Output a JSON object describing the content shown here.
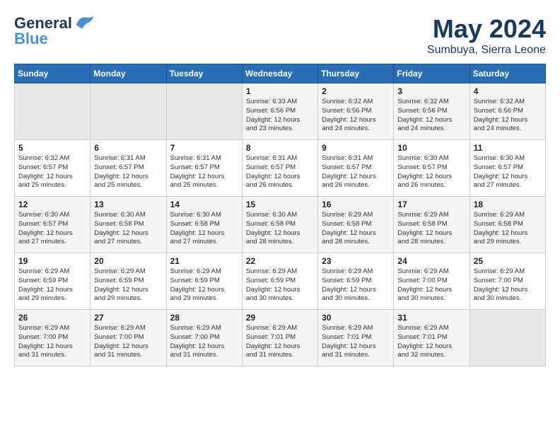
{
  "header": {
    "logo_line1": "General",
    "logo_line2": "Blue",
    "month": "May 2024",
    "location": "Sumbuya, Sierra Leone"
  },
  "weekdays": [
    "Sunday",
    "Monday",
    "Tuesday",
    "Wednesday",
    "Thursday",
    "Friday",
    "Saturday"
  ],
  "weeks": [
    [
      {
        "day": "",
        "info": ""
      },
      {
        "day": "",
        "info": ""
      },
      {
        "day": "",
        "info": ""
      },
      {
        "day": "1",
        "info": "Sunrise: 6:33 AM\nSunset: 6:56 PM\nDaylight: 12 hours\nand 23 minutes."
      },
      {
        "day": "2",
        "info": "Sunrise: 6:32 AM\nSunset: 6:56 PM\nDaylight: 12 hours\nand 24 minutes."
      },
      {
        "day": "3",
        "info": "Sunrise: 6:32 AM\nSunset: 6:56 PM\nDaylight: 12 hours\nand 24 minutes."
      },
      {
        "day": "4",
        "info": "Sunrise: 6:32 AM\nSunset: 6:56 PM\nDaylight: 12 hours\nand 24 minutes."
      }
    ],
    [
      {
        "day": "5",
        "info": "Sunrise: 6:32 AM\nSunset: 6:57 PM\nDaylight: 12 hours\nand 25 minutes."
      },
      {
        "day": "6",
        "info": "Sunrise: 6:31 AM\nSunset: 6:57 PM\nDaylight: 12 hours\nand 25 minutes."
      },
      {
        "day": "7",
        "info": "Sunrise: 6:31 AM\nSunset: 6:57 PM\nDaylight: 12 hours\nand 25 minutes."
      },
      {
        "day": "8",
        "info": "Sunrise: 6:31 AM\nSunset: 6:57 PM\nDaylight: 12 hours\nand 26 minutes."
      },
      {
        "day": "9",
        "info": "Sunrise: 6:31 AM\nSunset: 6:57 PM\nDaylight: 12 hours\nand 26 minutes."
      },
      {
        "day": "10",
        "info": "Sunrise: 6:30 AM\nSunset: 6:57 PM\nDaylight: 12 hours\nand 26 minutes."
      },
      {
        "day": "11",
        "info": "Sunrise: 6:30 AM\nSunset: 6:57 PM\nDaylight: 12 hours\nand 27 minutes."
      }
    ],
    [
      {
        "day": "12",
        "info": "Sunrise: 6:30 AM\nSunset: 6:57 PM\nDaylight: 12 hours\nand 27 minutes."
      },
      {
        "day": "13",
        "info": "Sunrise: 6:30 AM\nSunset: 6:58 PM\nDaylight: 12 hours\nand 27 minutes."
      },
      {
        "day": "14",
        "info": "Sunrise: 6:30 AM\nSunset: 6:58 PM\nDaylight: 12 hours\nand 27 minutes."
      },
      {
        "day": "15",
        "info": "Sunrise: 6:30 AM\nSunset: 6:58 PM\nDaylight: 12 hours\nand 28 minutes."
      },
      {
        "day": "16",
        "info": "Sunrise: 6:29 AM\nSunset: 6:58 PM\nDaylight: 12 hours\nand 28 minutes."
      },
      {
        "day": "17",
        "info": "Sunrise: 6:29 AM\nSunset: 6:58 PM\nDaylight: 12 hours\nand 28 minutes."
      },
      {
        "day": "18",
        "info": "Sunrise: 6:29 AM\nSunset: 6:58 PM\nDaylight: 12 hours\nand 29 minutes."
      }
    ],
    [
      {
        "day": "19",
        "info": "Sunrise: 6:29 AM\nSunset: 6:59 PM\nDaylight: 12 hours\nand 29 minutes."
      },
      {
        "day": "20",
        "info": "Sunrise: 6:29 AM\nSunset: 6:59 PM\nDaylight: 12 hours\nand 29 minutes."
      },
      {
        "day": "21",
        "info": "Sunrise: 6:29 AM\nSunset: 6:59 PM\nDaylight: 12 hours\nand 29 minutes."
      },
      {
        "day": "22",
        "info": "Sunrise: 6:29 AM\nSunset: 6:59 PM\nDaylight: 12 hours\nand 30 minutes."
      },
      {
        "day": "23",
        "info": "Sunrise: 6:29 AM\nSunset: 6:59 PM\nDaylight: 12 hours\nand 30 minutes."
      },
      {
        "day": "24",
        "info": "Sunrise: 6:29 AM\nSunset: 7:00 PM\nDaylight: 12 hours\nand 30 minutes."
      },
      {
        "day": "25",
        "info": "Sunrise: 6:29 AM\nSunset: 7:00 PM\nDaylight: 12 hours\nand 30 minutes."
      }
    ],
    [
      {
        "day": "26",
        "info": "Sunrise: 6:29 AM\nSunset: 7:00 PM\nDaylight: 12 hours\nand 31 minutes."
      },
      {
        "day": "27",
        "info": "Sunrise: 6:29 AM\nSunset: 7:00 PM\nDaylight: 12 hours\nand 31 minutes."
      },
      {
        "day": "28",
        "info": "Sunrise: 6:29 AM\nSunset: 7:00 PM\nDaylight: 12 hours\nand 31 minutes."
      },
      {
        "day": "29",
        "info": "Sunrise: 6:29 AM\nSunset: 7:01 PM\nDaylight: 12 hours\nand 31 minutes."
      },
      {
        "day": "30",
        "info": "Sunrise: 6:29 AM\nSunset: 7:01 PM\nDaylight: 12 hours\nand 31 minutes."
      },
      {
        "day": "31",
        "info": "Sunrise: 6:29 AM\nSunset: 7:01 PM\nDaylight: 12 hours\nand 32 minutes."
      },
      {
        "day": "",
        "info": ""
      }
    ]
  ]
}
